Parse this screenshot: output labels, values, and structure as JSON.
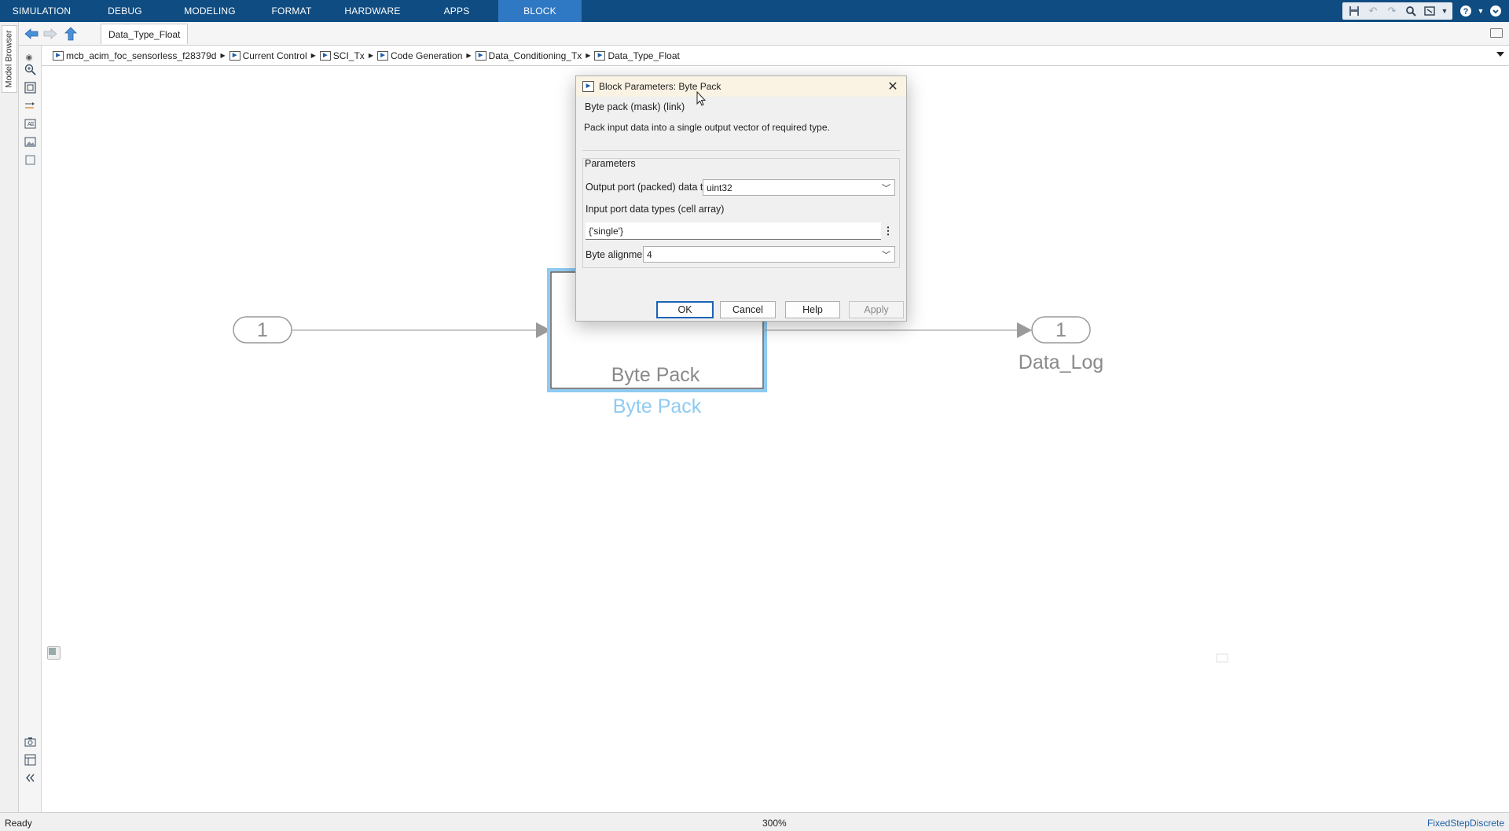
{
  "ribbon": {
    "tabs": [
      "SIMULATION",
      "DEBUG",
      "MODELING",
      "FORMAT",
      "HARDWARE",
      "APPS",
      "BLOCK"
    ],
    "active_tab": "BLOCK",
    "quick_access_icons": [
      "save-icon",
      "undo-icon",
      "redo-icon",
      "search-icon",
      "resize-icon",
      "dropdown-icon"
    ],
    "right_icons": [
      "help-icon",
      "dropdown-icon",
      "settings-icon"
    ]
  },
  "side_rail": {
    "model_browser_label": "Model Browser"
  },
  "nav": {
    "model_tab": "Data_Type_Float"
  },
  "breadcrumb": {
    "items": [
      "mcb_acim_foc_sensorless_f28379d",
      "Current Control",
      "SCI_Tx",
      "Code Generation",
      "Data_Conditioning_Tx",
      "Data_Type_Float"
    ]
  },
  "canvas": {
    "inport": {
      "number": "1"
    },
    "block": {
      "inner_label": "Byte Pack",
      "name": "Byte Pack",
      "selection_color": "#8ecbf2"
    },
    "outport": {
      "number": "1",
      "name": "Data_Log"
    }
  },
  "dialog": {
    "title": "Block Parameters: Byte Pack",
    "mask_title": "Byte pack (mask) (link)",
    "mask_description": "Pack input data into a single output vector of required type.",
    "params_group": "Parameters",
    "output_type_label": "Output port (packed) data type",
    "output_type_value": "uint32",
    "input_types_label": "Input port data types (cell array)",
    "input_types_value": "{'single'}",
    "alignment_label": "Byte alignment",
    "alignment_value": "4",
    "buttons": {
      "ok": "OK",
      "cancel": "Cancel",
      "help": "Help",
      "apply": "Apply"
    }
  },
  "status": {
    "state": "Ready",
    "zoom": "300%",
    "solver": "FixedStepDiscrete"
  }
}
